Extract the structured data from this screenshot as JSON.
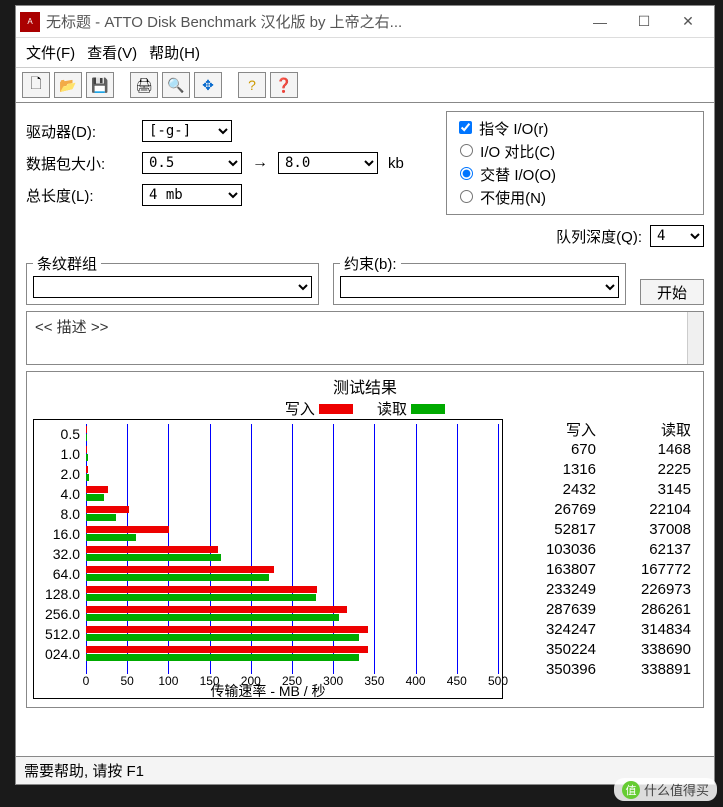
{
  "window": {
    "title": "无标题 - ATTO Disk Benchmark  汉化版 by 上帝之右..."
  },
  "menubar": {
    "file": "文件(F)",
    "view": "查看(V)",
    "help": "帮助(H)"
  },
  "toolbar_icons": [
    "new",
    "open",
    "save",
    "print",
    "preview",
    "move",
    "help",
    "whatsthis"
  ],
  "config": {
    "drive_label": "驱动器(D):",
    "drive_value": "[-g-]",
    "packet_label": "数据包大小:",
    "packet_from": "0.5",
    "packet_to": "8.0",
    "packet_unit": "kb",
    "length_label": "总长度(L):",
    "length_value": "4 mb"
  },
  "options": {
    "direct_io_label": "指令 I/O(r)",
    "direct_io_checked": true,
    "compare_label": "I/O 对比(C)",
    "overlap_label": "交替 I/O(O)",
    "neither_label": "不使用(N)",
    "mode_selected": "overlap"
  },
  "queue": {
    "label": "队列深度(Q):",
    "value": "4"
  },
  "groups": {
    "stripe_label": "条纹群组",
    "constraint_label": "约束(b):"
  },
  "start_button": "开始",
  "description_placeholder": "<< 描述 >>",
  "results": {
    "title": "测试结果",
    "write_label": "写入",
    "read_label": "读取",
    "xlabel": "传输速率 - MB / 秒",
    "col_write": "写入",
    "col_read": "读取"
  },
  "chart_data": {
    "type": "bar",
    "orientation": "horizontal",
    "categories": [
      "0.5",
      "1.0",
      "2.0",
      "4.0",
      "8.0",
      "16.0",
      "32.0",
      "64.0",
      "128.0",
      "256.0",
      "512.0",
      "024.0"
    ],
    "series": [
      {
        "name": "写入",
        "color": "#e00000",
        "values_kb": [
          670,
          1316,
          2432,
          26769,
          52817,
          103036,
          163807,
          233249,
          287639,
          324247,
          350224,
          350396
        ]
      },
      {
        "name": "读取",
        "color": "#00a000",
        "values_kb": [
          1468,
          2225,
          3145,
          22104,
          37008,
          62137,
          167772,
          226973,
          286261,
          314834,
          338690,
          338891
        ]
      }
    ],
    "xlim": [
      0,
      500
    ],
    "xticks": [
      0,
      50,
      100,
      150,
      200,
      250,
      300,
      350,
      400,
      450,
      500
    ],
    "xlabel": "传输速率 - MB / 秒",
    "ylabel": ""
  },
  "statusbar": "需要帮助, 请按 F1",
  "watermark": "什么值得买"
}
